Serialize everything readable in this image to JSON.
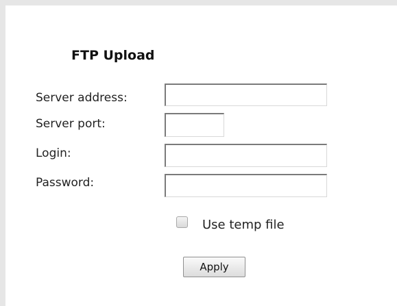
{
  "panel": {
    "title": "FTP Upload"
  },
  "form": {
    "server_address": {
      "label": "Server address:",
      "value": ""
    },
    "server_port": {
      "label": "Server port:",
      "value": ""
    },
    "login": {
      "label": "Login:",
      "value": ""
    },
    "password": {
      "label": "Password:",
      "value": ""
    },
    "use_temp_file": {
      "label": "Use temp file",
      "checked": false
    },
    "apply_label": "Apply"
  }
}
